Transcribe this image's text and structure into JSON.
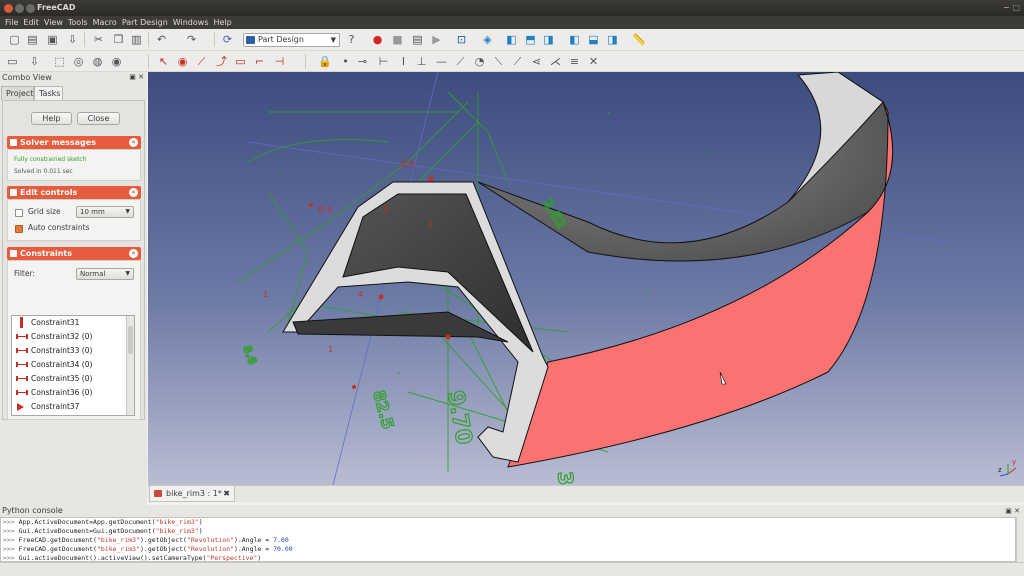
{
  "window": {
    "title": "FreeCAD",
    "right_controls": "− □"
  },
  "menu": [
    "File",
    "Edit",
    "View",
    "Tools",
    "Macro",
    "Part Design",
    "Windows",
    "Help"
  ],
  "toolbar": {
    "workbench": "Part Design",
    "row1_icons": [
      "new-icon",
      "open-icon",
      "save-icon",
      "save-as-icon",
      "cut-icon",
      "copy-icon",
      "paste-icon",
      "undo-icon",
      "redo-icon",
      "refresh-icon",
      "whats-this-icon",
      "record-macro-icon",
      "stop-macro-icon",
      "edit-macro-icon",
      "run-macro-icon",
      "fit-all-icon",
      "isometric-view-icon",
      "front-view-icon",
      "top-view-icon",
      "right-view-icon",
      "rear-view-icon",
      "bottom-view-icon",
      "left-view-icon",
      "measure-icon"
    ],
    "row2_icons": [
      "new-sketch-icon",
      "edit-sketch-icon",
      "pad-icon",
      "pocket-icon",
      "revolution-icon",
      "groove-icon",
      "point-icon",
      "circle-icon",
      "line-icon",
      "polyline-icon",
      "rectangle-icon",
      "arc-icon",
      "constrain-lock-icon",
      "constrain-point-icon",
      "constrain-coincident-icon",
      "constrain-horizontal-icon",
      "constrain-vertical-icon",
      "constrain-parallel-icon",
      "constrain-perpendicular-icon",
      "constrain-tangent-icon",
      "constrain-equal-icon",
      "constrain-symmetric-icon",
      "constrain-distance-icon",
      "constrain-distance-x-icon",
      "constrain-distance-y-icon",
      "constrain-radius-icon",
      "constrain-angle-icon",
      "close-sketch-icon"
    ]
  },
  "combo": {
    "title": "Combo View",
    "header_icons": "▣ ✕",
    "tabs": [
      "Project",
      "Tasks"
    ],
    "buttons": {
      "help": "Help",
      "close": "Close"
    },
    "solver": {
      "title": "Solver messages",
      "status": "Fully constrained sketch",
      "time": "Solved in 0.011 sec"
    },
    "edit_controls": {
      "title": "Edit controls",
      "grid_label": "Grid size",
      "grid_value": "10 mm",
      "auto_label": "Auto constraints"
    },
    "constraints": {
      "title": "Constraints",
      "filter_label": "Filter:",
      "filter_value": "Normal",
      "items": [
        "Constraint31",
        "Constraint32 (0)",
        "Constraint33 (0)",
        "Constraint34 (0)",
        "Constraint35 (0)",
        "Constraint36 (0)",
        "Constraint37"
      ]
    }
  },
  "document_tab": {
    "label": "bike_rim3 : 1*",
    "close": "✖"
  },
  "python": {
    "title": "Python console",
    "header_icons": "▣ ✕",
    "prompt": ">>>",
    "lines": [
      {
        "pre": "App.ActiveDocument=App.getDocument(",
        "s1": "\"bike_rim3\"",
        "mid": ")",
        "s2": "",
        "post": "",
        "n": ""
      },
      {
        "pre": "Gui.ActiveDocument=Gui.getDocument(",
        "s1": "\"bike_rim3\"",
        "mid": ")",
        "s2": "",
        "post": "",
        "n": ""
      },
      {
        "pre": "FreeCAD.getDocument(",
        "s1": "\"bike_rim3\"",
        "mid": ").getObject(",
        "s2": "\"Revolution\"",
        "post": ").Angle = ",
        "n": "7.00"
      },
      {
        "pre": "FreeCAD.getDocument(",
        "s1": "\"bike_rim3\"",
        "mid": ").getObject(",
        "s2": "\"Revolution\"",
        "post": ").Angle = ",
        "n": "70.00"
      },
      {
        "pre": "Gui.activeDocument().activeView().setCameraType(",
        "s1": "\"Perspective\"",
        "mid": ")",
        "s2": "",
        "post": "",
        "n": ""
      }
    ]
  },
  "colors": {
    "accent": "#e65c3c",
    "constraint_red": "#c62f22",
    "sketch_green": "#2fa02a",
    "rim_salmon": "#fb7272",
    "rim_gray": "#6b6b6b"
  },
  "viewport": {
    "dims": [
      {
        "text": "Ø 8"
      },
      {
        "text": "9.70"
      },
      {
        "text": "82.5"
      },
      {
        "text": "325"
      },
      {
        "text": "8.6"
      },
      {
        "text": "2.62"
      }
    ]
  }
}
